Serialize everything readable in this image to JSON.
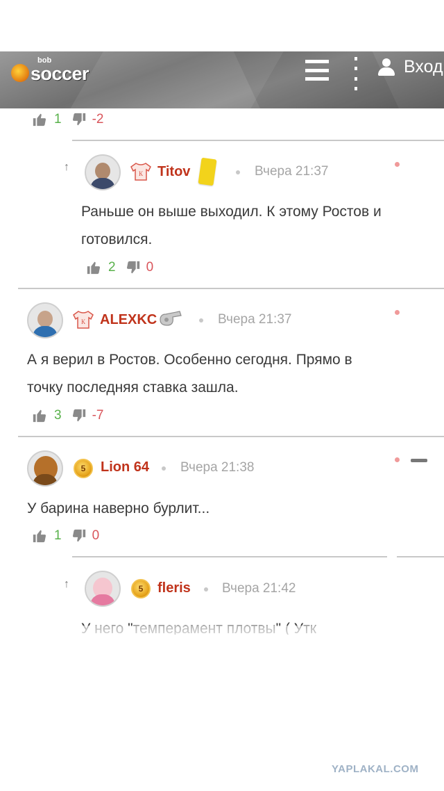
{
  "header": {
    "logo_small": "bob",
    "logo_big": "soccer",
    "login_label": "Вход"
  },
  "top_rating": {
    "up": "1",
    "down": "-2"
  },
  "comments": [
    {
      "user": "Titov",
      "time": "Вчера 21:37",
      "text_lines": [
        "Раньше он выше выходил. К этому Ростов и",
        "готовился."
      ],
      "up": "2",
      "down": "0"
    },
    {
      "user": "ALEXKC",
      "time": "Вчера 21:37",
      "text_lines": [
        "А я верил в Ростов. Особенно сегодня. Прямо в",
        "точку последняя ставка зашла."
      ],
      "up": "3",
      "down": "-7"
    },
    {
      "user": "Lion 64",
      "time": "Вчера 21:38",
      "text_lines": [
        "У барина наверно бурлит..."
      ],
      "up": "1",
      "down": "0",
      "medal": "5"
    },
    {
      "user": "fleris",
      "time": "Вчера 21:42",
      "text_lines": [
        "У него \"темперамент плотвы\" ( Утк"
      ],
      "medal": "5"
    }
  ],
  "watermark": "YAPLAKAL.COM",
  "colors": {
    "username": "#c0331b",
    "upvote": "#58b14a",
    "downvote": "#d9555b",
    "header_bg": "#7a7a7a"
  }
}
